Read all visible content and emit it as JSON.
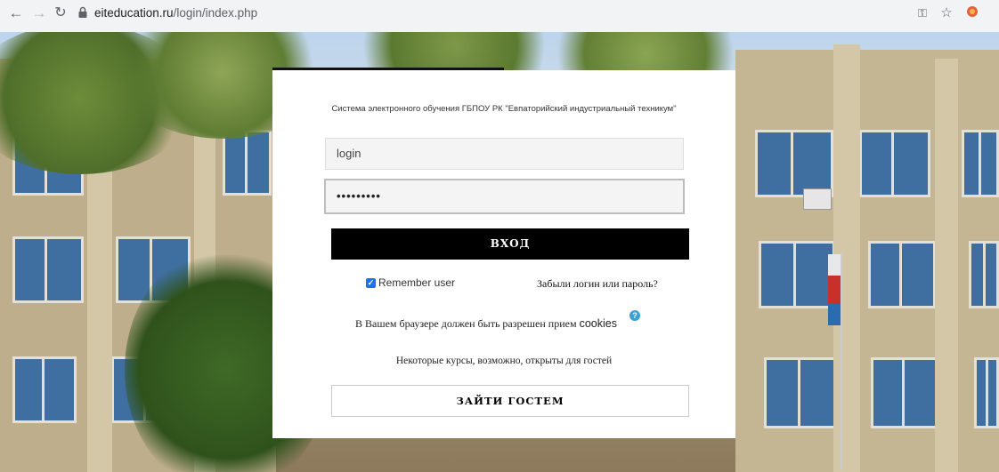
{
  "browser": {
    "url_domain": "eiteducation.ru",
    "url_path": "/login/index.php",
    "icons": [
      "back-icon",
      "forward-icon",
      "reload-icon",
      "lock-icon",
      "key-icon",
      "star-icon",
      "extension-icon"
    ]
  },
  "login": {
    "site_title": "Система электронного обучения ГБПОУ РК \"Евпаторийский индустриальный техникум\"",
    "username_value": "login",
    "password_mask": "•••••••••",
    "login_button": "ВХОД",
    "remember_label": "Remember user",
    "forgot_link": "Забыли логин или пароль?",
    "cookies_text": "В Вашем браузере должен быть разрешен прием ",
    "cookies_word": "cookies",
    "guest_note": "Некоторые курсы, возможно, открыты для гостей",
    "guest_button": "ЗАЙТИ ГОСТЕМ"
  },
  "colors": {
    "login_button_bg": "#000000",
    "checkbox_accent": "#1a73e8",
    "help_icon": "#3aa0d6"
  }
}
